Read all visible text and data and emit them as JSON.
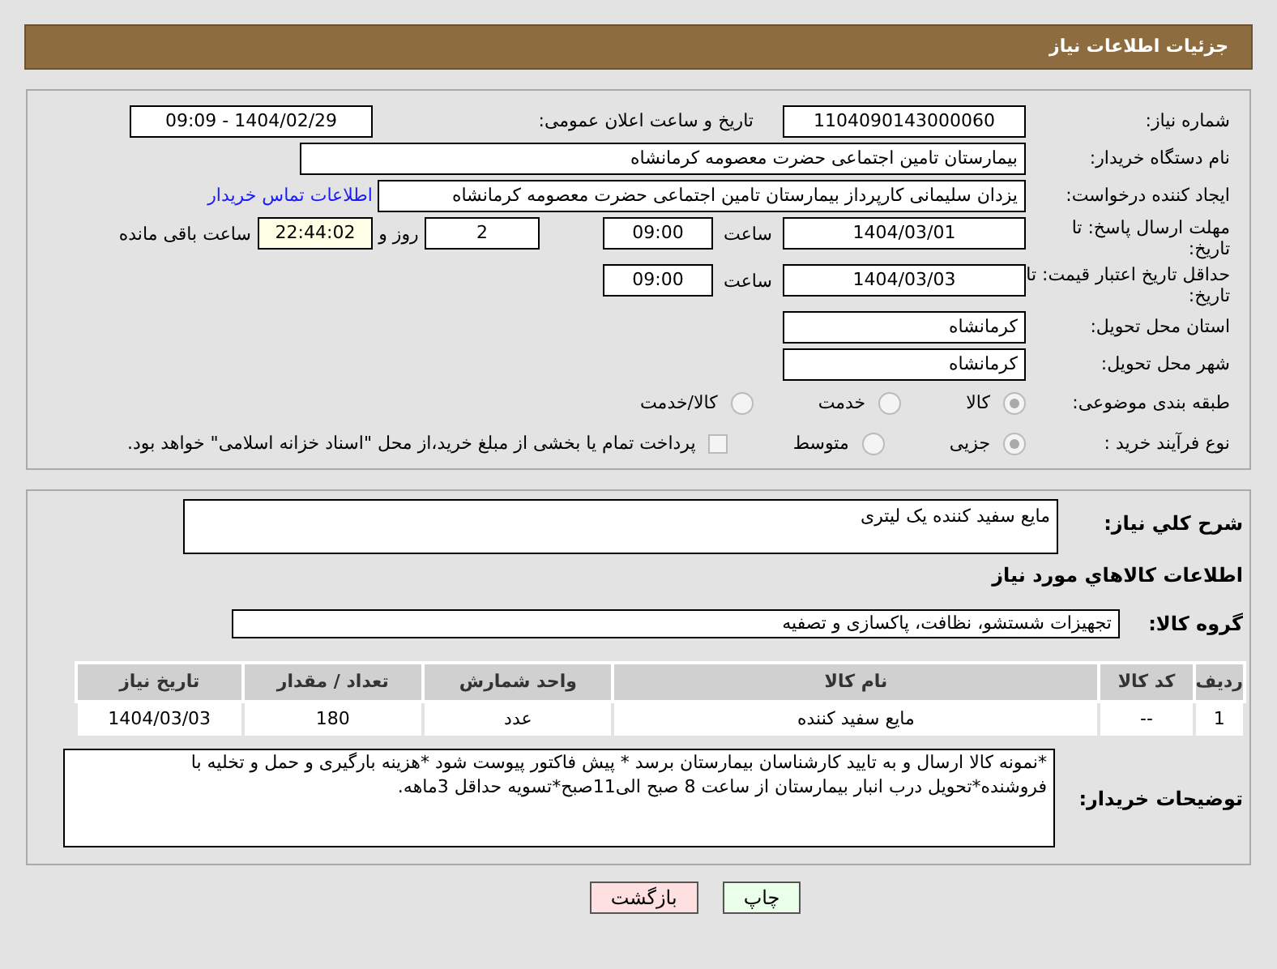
{
  "header": {
    "title": "جزئیات اطلاعات نیاز"
  },
  "need_number": {
    "label": "شماره نیاز:",
    "value": "1104090143000060"
  },
  "announce": {
    "label": "تاریخ و ساعت اعلان عمومی:",
    "value": "1404/02/29 - 09:09"
  },
  "buyer": {
    "label": "نام دستگاه خریدار:",
    "value": "بیمارستان تامین اجتماعی حضرت معصومه کرمانشاه"
  },
  "creator": {
    "label": "ایجاد کننده درخواست:",
    "value": "یزدان  سلیمانی کارپرداز بیمارستان تامین اجتماعی حضرت معصومه کرمانشاه",
    "link": "اطلاعات تماس خریدار"
  },
  "deadline": {
    "label": "مهلت ارسال پاسخ: تا تاریخ:",
    "date": "1404/03/01",
    "time_label": "ساعت",
    "time": "09:00",
    "days": "2",
    "days_label": "روز و",
    "remaining": "22:44:02",
    "remaining_label": "ساعت باقی مانده"
  },
  "validity": {
    "label": "حداقل تاریخ اعتبار قیمت: تا تاریخ:",
    "date": "1404/03/03",
    "time_label": "ساعت",
    "time": "09:00"
  },
  "province": {
    "label": "استان محل تحویل:",
    "value": "کرمانشاه"
  },
  "city": {
    "label": "شهر محل تحویل:",
    "value": "کرمانشاه"
  },
  "category": {
    "label": "طبقه بندی موضوعی:",
    "options": [
      {
        "label": "کالا",
        "selected": true
      },
      {
        "label": "خدمت",
        "selected": false
      },
      {
        "label": "کالا/خدمت",
        "selected": false
      }
    ]
  },
  "process": {
    "label": "نوع فرآیند خرید :",
    "options": [
      {
        "label": "جزیی",
        "selected": true
      },
      {
        "label": "متوسط",
        "selected": false
      }
    ],
    "checkbox": {
      "label": "پرداخت تمام یا بخشی از مبلغ خرید،از محل \"اسناد خزانه اسلامی\" خواهد بود.",
      "checked": false
    }
  },
  "summary": {
    "label": "شرح کلي نياز:",
    "value": "مایع سفید کننده یک لیتری"
  },
  "goods_heading": "اطلاعات کالاهاي مورد نياز",
  "goods_group": {
    "label": "گروه کالا:",
    "value": "تجهیزات شستشو، نظافت، پاکسازی و تصفیه"
  },
  "table": {
    "columns": [
      "ردیف",
      "کد کالا",
      "نام کالا",
      "واحد شمارش",
      "تعداد / مقدار",
      "تاریخ نیاز"
    ],
    "rows": [
      [
        "1",
        "--",
        "مایع سفید کننده",
        "عدد",
        "180",
        "1404/03/03"
      ]
    ]
  },
  "notes": {
    "label": "توضیحات خریدار:",
    "value": "*نمونه کالا ارسال و به تایید کارشناسان بیمارستان برسد *  پیش فاکتور پیوست شود *هزینه بارگیری و حمل و تخلیه با فروشنده*تحویل درب انبار بیمارستان از ساعت 8 صبح الی11صبح*تسویه حداقل 3ماهه."
  },
  "buttons": [
    {
      "kind": "print",
      "label": "چاپ"
    },
    {
      "kind": "back",
      "label": "بازگشت"
    }
  ]
}
